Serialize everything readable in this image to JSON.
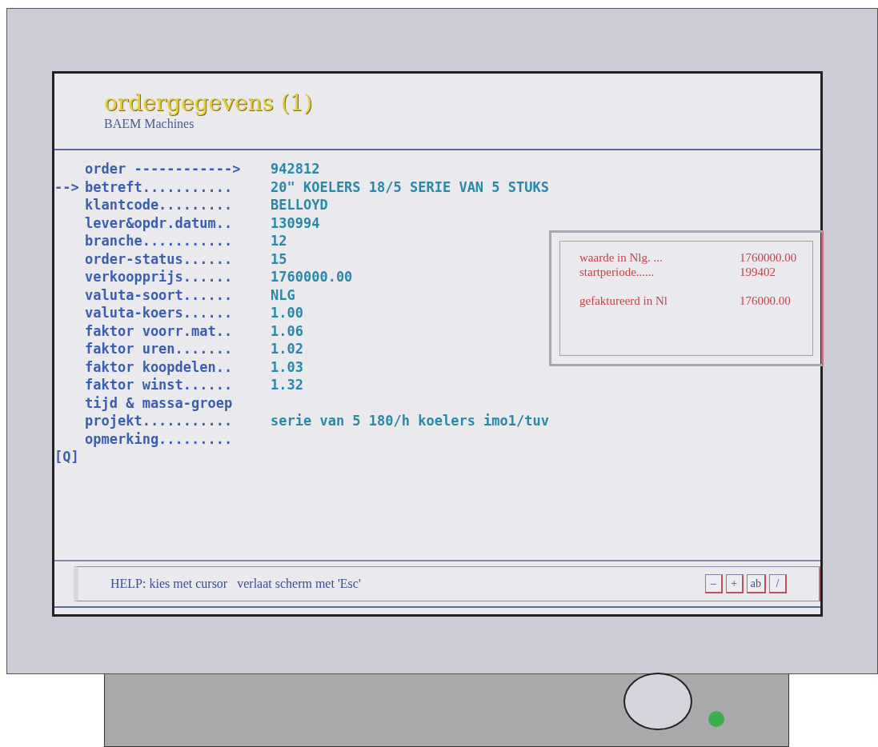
{
  "header": {
    "title": "ordergegevens (1)",
    "subtitle": "BAEM Machines"
  },
  "fields": [
    {
      "label": "order ------------>",
      "value": "942812"
    },
    {
      "label": "betreft...........",
      "value": "20\" KOELERS 18/5 SERIE VAN 5 STUKS",
      "pointer": "-->"
    },
    {
      "label": "klantcode.........",
      "value": "BELLOYD"
    },
    {
      "label": "lever&opdr.datum..",
      "value": "130994"
    },
    {
      "label": "branche...........",
      "value": "12"
    },
    {
      "label": "order-status......",
      "value": "15"
    },
    {
      "label": "verkoopprijs......",
      "value": "1760000.00"
    },
    {
      "label": "valuta-soort......",
      "value": "NLG"
    },
    {
      "label": "valuta-koers......",
      "value": "1.00"
    },
    {
      "label": "faktor voorr.mat..",
      "value": "1.06"
    },
    {
      "label": "faktor uren.......",
      "value": "1.02"
    },
    {
      "label": "faktor koopdelen..",
      "value": "1.03"
    },
    {
      "label": "faktor winst......",
      "value": "1.32"
    },
    {
      "label": "tijd & massa-groep"
    },
    {
      "label": "projekt...........",
      "value": "serie van 5 180/h koelers imo1/tuv"
    },
    {
      "label": "opmerking........."
    }
  ],
  "prompt": "[Q]",
  "summary": [
    {
      "label": "waarde in Nlg. ...",
      "value": "1760000.00"
    },
    {
      "label": "startperiode......",
      "value": "199402"
    },
    {
      "label": "gefaktureerd in Nl",
      "value": "176000.00"
    }
  ],
  "help": {
    "text": "HELP: kies met cursor   verlaat scherm met 'Esc'",
    "buttons": [
      "–",
      "+",
      "ab",
      "/"
    ]
  }
}
